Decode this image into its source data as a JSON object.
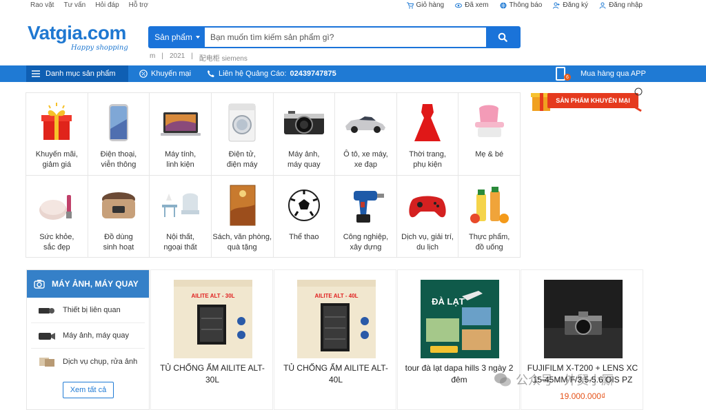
{
  "topbar": {
    "left_links": [
      "Rao vặt",
      "Tư vấn",
      "Hỏi đáp",
      "Hỗ trợ"
    ],
    "right_links": [
      {
        "label": "Giỏ hàng",
        "icon": "cart-icon"
      },
      {
        "label": "Đã xem",
        "icon": "eye-icon"
      },
      {
        "label": "Thông báo",
        "icon": "globe-icon"
      },
      {
        "label": "Đăng ký",
        "icon": "user-add-icon"
      },
      {
        "label": "Đăng nhập",
        "icon": "user-icon"
      }
    ]
  },
  "header": {
    "logo_text": "Vatgia.com",
    "logo_tagline": "Happy shopping",
    "search_category": "Sản phẩm",
    "search_placeholder": "Bạn muốn tìm kiếm sản phẩm gì?",
    "suggestions": [
      "m",
      "2021",
      "配电柜 siemens"
    ]
  },
  "nav": {
    "menu_label": "Danh mục sản phẩm",
    "promo_label": "Khuyến mại",
    "ad_label": "Liên hệ Quảng Cáo:",
    "ad_phone": "02439747875",
    "app_label": "Mua hàng qua APP",
    "app_badge": "6"
  },
  "promo_banner": "SẢN PHẨM KHUYẾN MẠI",
  "categories": [
    {
      "label": "Khuyến mãi,\ngiảm giá",
      "icon": "gift-icon"
    },
    {
      "label": "Điện thoại,\nviễn thông",
      "icon": "phone-icon"
    },
    {
      "label": "Máy tính,\nlinh kiện",
      "icon": "laptop-icon"
    },
    {
      "label": "Điện tử,\nđiện máy",
      "icon": "washer-icon"
    },
    {
      "label": "Máy ảnh,\nmáy quay",
      "icon": "camera-icon"
    },
    {
      "label": "Ô tô, xe máy,\nxe đạp",
      "icon": "car-icon"
    },
    {
      "label": "Thời trang,\nphụ kiện",
      "icon": "dress-icon"
    },
    {
      "label": "Mẹ & bé",
      "icon": "baby-chair-icon"
    },
    {
      "label": "Sức khỏe,\nsắc đẹp",
      "icon": "cosmetics-icon"
    },
    {
      "label": "Đồ dùng\nsinh hoạt",
      "icon": "rice-cooker-icon"
    },
    {
      "label": "Nội thất,\nngoại thất",
      "icon": "furniture-icon"
    },
    {
      "label": "Sách, văn phòng,\nquà tặng",
      "icon": "book-icon"
    },
    {
      "label": "Thể thao",
      "icon": "football-icon"
    },
    {
      "label": "Công nghiệp,\nxây dựng",
      "icon": "drill-icon"
    },
    {
      "label": "Dịch vụ, giải trí,\ndu lịch",
      "icon": "gamepad-icon"
    },
    {
      "label": "Thực phẩm,\nđồ uống",
      "icon": "juice-icon"
    }
  ],
  "camera_section": {
    "title": "MÁY ẢNH, MÁY QUAY",
    "items": [
      "Thiết bị liên quan",
      "Máy ảnh, máy quay",
      "Dịch vụ chụp, rửa ảnh"
    ],
    "view_all": "Xem tất cả"
  },
  "products": [
    {
      "name": "TỦ CHỐNG ẨM AILITE ALT-30L",
      "price": "",
      "image_title": "AILITE ALT - 30L"
    },
    {
      "name": "TỦ CHỐNG ẨM AILITE ALT-40L",
      "price": "",
      "image_title": "AILITE ALT - 40L"
    },
    {
      "name": "tour đà lạt dapa hills 3 ngày 2 đêm",
      "price": "",
      "image_title": "ĐÀ LẠT"
    },
    {
      "name": "FUJIFILM X-T200 + LENS XC 15-45MM F/3.5-5.6 OIS PZ",
      "price": "19.000.000₫",
      "image_title": ""
    }
  ],
  "watermark": "公众号 · 外贸小厮",
  "colors": {
    "brand_blue": "#1f7ad4",
    "price_orange": "#e5531a",
    "promo_red": "#e53a1e"
  }
}
